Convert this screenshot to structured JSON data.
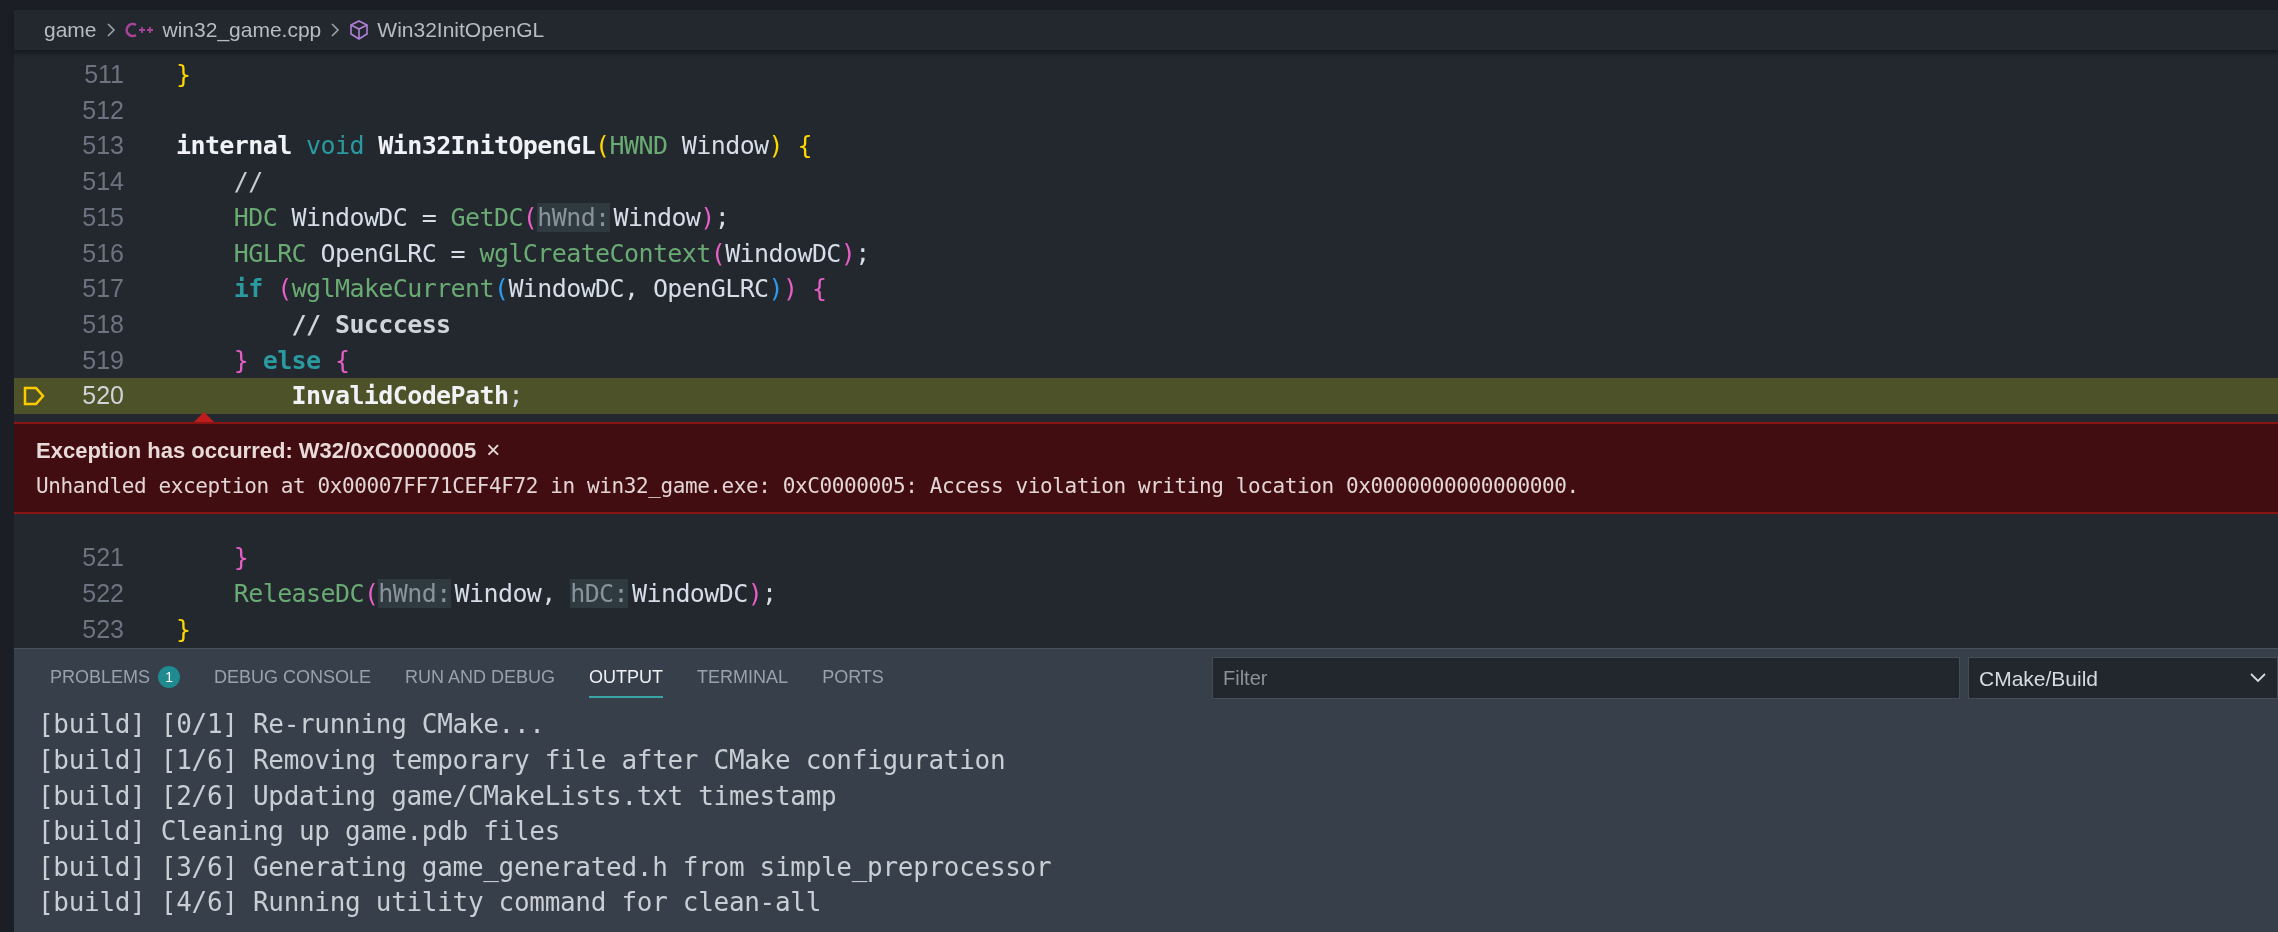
{
  "breadcrumbs": [
    {
      "kind": "folder",
      "label": "game"
    },
    {
      "kind": "cpp-file",
      "label": "win32_game.cpp"
    },
    {
      "kind": "symbol",
      "label": "Win32InitOpenGL"
    }
  ],
  "editor": {
    "lines_before": [
      {
        "number": "511",
        "current": false,
        "tokens": [
          {
            "t": "}",
            "kind": "b1"
          }
        ]
      },
      {
        "number": "512",
        "current": false
      },
      {
        "number": "513",
        "current": false,
        "tokens": [
          {
            "t": "internal ",
            "kind": "kw"
          },
          {
            "t": "void ",
            "kind": "kw2"
          },
          {
            "t": "Win32InitOpenGL",
            "kind": "fn"
          },
          {
            "t": "(",
            "kind": "b1"
          },
          {
            "t": "HWND",
            "kind": "type"
          },
          {
            "t": " Window",
            "kind": "var"
          },
          {
            "t": ")",
            "kind": "b1"
          },
          {
            "t": " {",
            "kind": "b1"
          }
        ]
      },
      {
        "number": "514",
        "current": false,
        "tokens": [
          {
            "t": "    //",
            "kind": "comment"
          }
        ]
      },
      {
        "number": "515",
        "current": false,
        "tokens": [
          {
            "t": "    HDC",
            "kind": "type"
          },
          {
            "t": " WindowDC = ",
            "kind": "var"
          },
          {
            "t": "GetDC",
            "kind": "type"
          },
          {
            "t": "(",
            "kind": "b2"
          },
          {
            "t": "hWnd:",
            "kind": "hint"
          },
          {
            "t": "Window",
            "kind": "var"
          },
          {
            "t": ")",
            "kind": "b2"
          },
          {
            "t": ";",
            "kind": "var"
          }
        ]
      },
      {
        "number": "516",
        "current": false,
        "tokens": [
          {
            "t": "    HGLRC",
            "kind": "type"
          },
          {
            "t": " OpenGLRC = ",
            "kind": "var"
          },
          {
            "t": "wglCreateContext",
            "kind": "type"
          },
          {
            "t": "(",
            "kind": "b2"
          },
          {
            "t": "WindowDC",
            "kind": "var"
          },
          {
            "t": ")",
            "kind": "b2"
          },
          {
            "t": ";",
            "kind": "var"
          }
        ]
      },
      {
        "number": "517",
        "current": false,
        "tokens": [
          {
            "t": "    if ",
            "kind": "ctrl"
          },
          {
            "t": "(",
            "kind": "b2"
          },
          {
            "t": "wglMakeCurrent",
            "kind": "type"
          },
          {
            "t": "(",
            "kind": "b3"
          },
          {
            "t": "WindowDC, OpenGLRC",
            "kind": "var"
          },
          {
            "t": ")",
            "kind": "b3"
          },
          {
            "t": ") {",
            "kind": "b2"
          }
        ]
      },
      {
        "number": "518",
        "current": false,
        "tokens": [
          {
            "t": "        // Succcess",
            "kind": "comment-bold"
          }
        ]
      },
      {
        "number": "519",
        "current": false,
        "tokens": [
          {
            "t": "    } ",
            "kind": "b2"
          },
          {
            "t": "else ",
            "kind": "ctrl"
          },
          {
            "t": "{",
            "kind": "b2"
          }
        ]
      },
      {
        "number": "520",
        "current": true,
        "tokens": [
          {
            "t": "        InvalidCodePath",
            "kind": "fn"
          },
          {
            "t": ";",
            "kind": "var"
          }
        ]
      }
    ],
    "exception": {
      "title": "Exception has occurred: W32/0xC0000005",
      "close": "×",
      "message": "Unhandled exception at 0x00007FF71CEF4F72 in win32_game.exe: 0xC0000005: Access violation writing location 0x0000000000000000."
    },
    "lines_after": [
      {
        "number": "521",
        "current": false,
        "tokens": [
          {
            "t": "    }",
            "kind": "b2"
          }
        ]
      },
      {
        "number": "522",
        "current": false,
        "tokens": [
          {
            "t": "    ReleaseDC",
            "kind": "type"
          },
          {
            "t": "(",
            "kind": "b2"
          },
          {
            "t": "hWnd:",
            "kind": "hint"
          },
          {
            "t": "Window, ",
            "kind": "var"
          },
          {
            "t": "hDC:",
            "kind": "hint"
          },
          {
            "t": "WindowDC",
            "kind": "var"
          },
          {
            "t": ")",
            "kind": "b2"
          },
          {
            "t": ";",
            "kind": "var"
          }
        ]
      },
      {
        "number": "523",
        "current": false,
        "tokens": [
          {
            "t": "}",
            "kind": "b1"
          }
        ]
      }
    ]
  },
  "panel": {
    "tabs": [
      {
        "label": "PROBLEMS",
        "badge": "1",
        "selected": false
      },
      {
        "label": "DEBUG CONSOLE",
        "selected": false
      },
      {
        "label": "RUN AND DEBUG",
        "selected": false
      },
      {
        "label": "OUTPUT",
        "selected": true
      },
      {
        "label": "TERMINAL",
        "selected": false
      },
      {
        "label": "PORTS",
        "selected": false
      }
    ],
    "filter": {
      "placeholder": "Filter"
    },
    "channel": "CMake/Build",
    "output": [
      "[build] [0/1] Re-running CMake...",
      "[build] [1/6] Removing temporary file after CMake configuration",
      "[build] [2/6] Updating game/CMakeLists.txt timestamp",
      "[build] Cleaning up game.pdb files",
      "[build] [3/6] Generating game_generated.h from simple_preprocessor",
      "[build] [4/6] Running utility command for clean-all"
    ]
  }
}
